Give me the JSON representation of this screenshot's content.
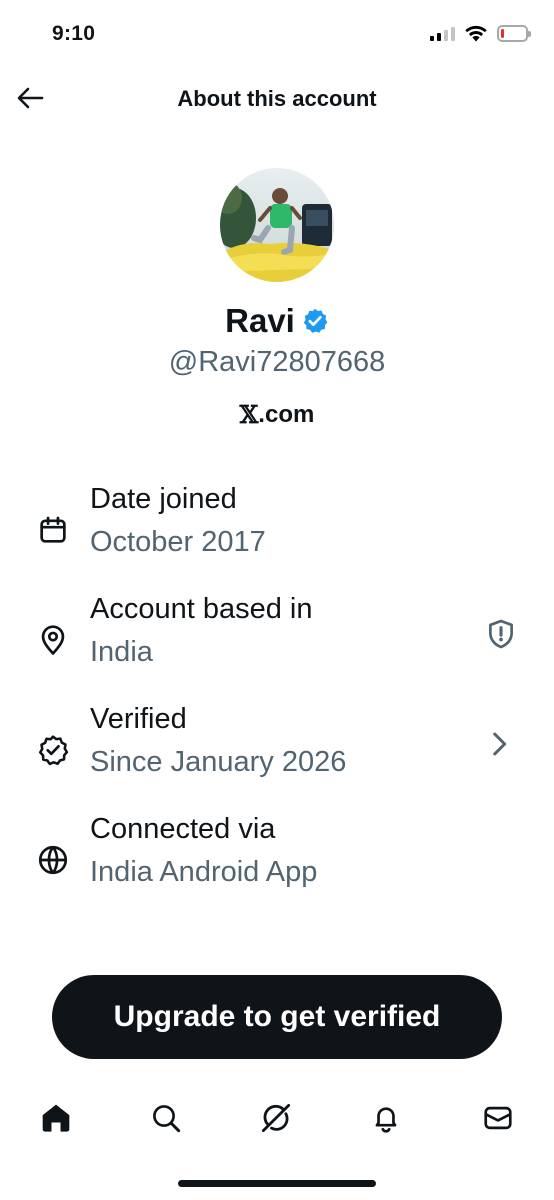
{
  "status_bar": {
    "time": "9:10",
    "signal_bars_on": 2,
    "signal_bars_total": 4,
    "battery_level": 0.15,
    "battery_color": "#e0312f"
  },
  "header": {
    "title": "About this account",
    "back_icon": "arrow-left-icon"
  },
  "profile": {
    "name": "Ravi",
    "verified_badge_color": "#1d9bf0",
    "handle": "@Ravi72807668",
    "site_mark": "𝕏",
    "site_suffix": ".com"
  },
  "info": [
    {
      "icon": "calendar-icon",
      "title": "Date joined",
      "value": "October 2017"
    },
    {
      "icon": "location-pin-icon",
      "title": "Account based in",
      "value": "India",
      "trailing_icon": "shield-alert-icon"
    },
    {
      "icon": "verified-badge-outline-icon",
      "title": "Verified",
      "value": "Since January 2026",
      "trailing_icon": "chevron-right-icon"
    },
    {
      "icon": "globe-icon",
      "title": "Connected via",
      "value": "India Android App"
    }
  ],
  "cta": {
    "label": "Upgrade to get verified"
  },
  "tab_bar": {
    "tabs": [
      "home-icon",
      "search-icon",
      "grok-icon",
      "notifications-bell-icon",
      "messages-envelope-icon"
    ],
    "active": "home-icon"
  },
  "colors": {
    "text_primary": "#0f1419",
    "text_secondary": "#536471",
    "button_bg": "#0f1419"
  }
}
